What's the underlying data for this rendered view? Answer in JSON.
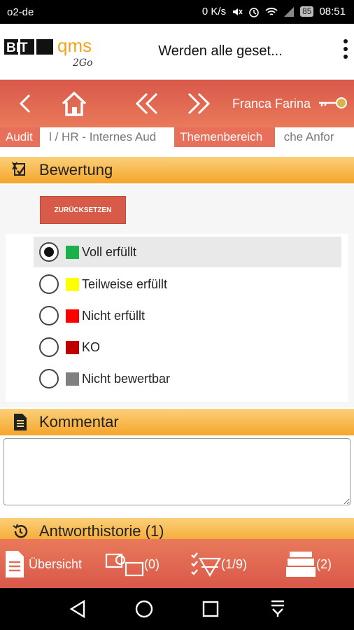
{
  "status_bar": {
    "carrier": "o2-de",
    "speed": "0 K/s",
    "battery": "85",
    "time": "08:51"
  },
  "header": {
    "logo_text_1": "BIT",
    "logo_text_2": "qms",
    "logo_text_3": "2Go",
    "title": "Werden alle geset...",
    "menu_icon": "more-vert-icon"
  },
  "nav": {
    "user_name": "Franca Farina",
    "icons": [
      "back-icon",
      "home-icon",
      "double-chevron-left-icon",
      "double-chevron-right-icon",
      "key-icon"
    ]
  },
  "tabs": [
    {
      "label": "Audit",
      "style": "orange"
    },
    {
      "label": "l / HR - Internes Aud",
      "style": "plain"
    },
    {
      "label": "Themenbereich",
      "style": "orange"
    },
    {
      "label": "che Anfor",
      "style": "plain"
    }
  ],
  "bewertung": {
    "title": "Bewertung",
    "icon": "rating-icon",
    "reset_label": "ZURÜCKSETZEN",
    "options": [
      {
        "label": "Voll erfüllt",
        "color": "#1ab04a",
        "selected": true
      },
      {
        "label": "Teilweise erfüllt",
        "color": "#ffff00",
        "selected": false
      },
      {
        "label": "Nicht erfüllt",
        "color": "#ff0000",
        "selected": false
      },
      {
        "label": "KO",
        "color": "#c00000",
        "selected": false
      },
      {
        "label": "Nicht bewertbar",
        "color": "#808080",
        "selected": false
      }
    ]
  },
  "kommentar": {
    "title": "Kommentar",
    "icon": "document-icon",
    "value": ""
  },
  "history": {
    "title": "Antworthistorie (1)",
    "icon": "history-icon"
  },
  "toolbar": {
    "overview_label": "Übersicht",
    "attachments_count": "(0)",
    "progress": "(1/9)",
    "archive_count": "(2)"
  },
  "colors": {
    "accent": "#d9584a",
    "section": "#f5a52a"
  }
}
